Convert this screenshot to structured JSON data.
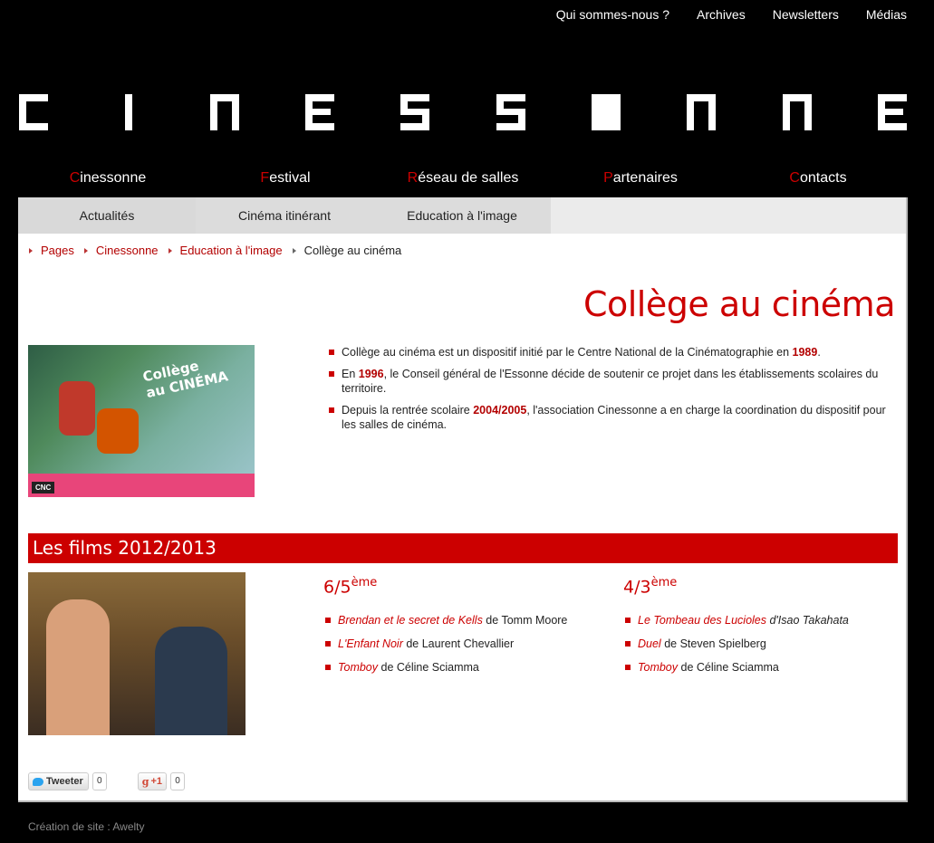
{
  "top_links": [
    "Qui sommes-nous ?",
    "Archives",
    "Newsletters",
    "Médias"
  ],
  "logo_text": "CINESSONNE",
  "main_nav": [
    {
      "first": "C",
      "rest": "inessonne"
    },
    {
      "first": "F",
      "rest": "estival"
    },
    {
      "first": "R",
      "rest": "éseau de salles"
    },
    {
      "first": "P",
      "rest": "artenaires"
    },
    {
      "first": "C",
      "rest": "ontacts"
    }
  ],
  "sub_nav": [
    "Actualités",
    "Cinéma itinérant",
    "Education à l'image"
  ],
  "breadcrumb": [
    "Pages",
    "Cinessonne",
    "Education à l'image",
    "Collège au cinéma"
  ],
  "page_title": "Collège au cinéma",
  "poster": {
    "badge_line1": "Collège",
    "badge_line2": "au CINÉMA",
    "logo": "CNC"
  },
  "points": [
    {
      "a": "Collège au cinéma est un dispositif initié par le Centre National de la Cinématographie en ",
      "hl": "1989",
      "b": "."
    },
    {
      "a": "En ",
      "hl": "1996",
      "b": ", le Conseil général de l'Essonne décide de soutenir ce projet dans les établissements scolaires du territoire."
    },
    {
      "a": "Depuis la rentrée scolaire ",
      "hl": "2004/2005",
      "b": ", l'association Cinessonne a en charge la coordination du dispositif pour les salles de cinéma."
    }
  ],
  "section_title": "Les films 2012/2013",
  "col1": {
    "heading": "6/5",
    "sup": "ème",
    "films": [
      {
        "title": "Brendan et le secret de Kells",
        "by": " de Tomm Moore"
      },
      {
        "title": "L'Enfant Noir",
        "by": " de Laurent Chevallier"
      },
      {
        "title": "Tomboy",
        "by": " de Céline Sciamma"
      }
    ]
  },
  "col2": {
    "heading": "4/3",
    "sup": "ème",
    "films": [
      {
        "title": "Le Tombeau des Lucioles",
        "by": " d'Isao Takahata"
      },
      {
        "title": "Duel",
        "by": " de Steven Spielberg"
      },
      {
        "title": "Tomboy",
        "by": " de Céline Sciamma"
      }
    ]
  },
  "social": {
    "tweet_label": "Tweeter",
    "tweet_count": "0",
    "gplus_label": "+1",
    "gplus_count": "0"
  },
  "footer": "Création de site : Awelty",
  "colors": {
    "accent": "#cc0000",
    "background": "#000000"
  }
}
